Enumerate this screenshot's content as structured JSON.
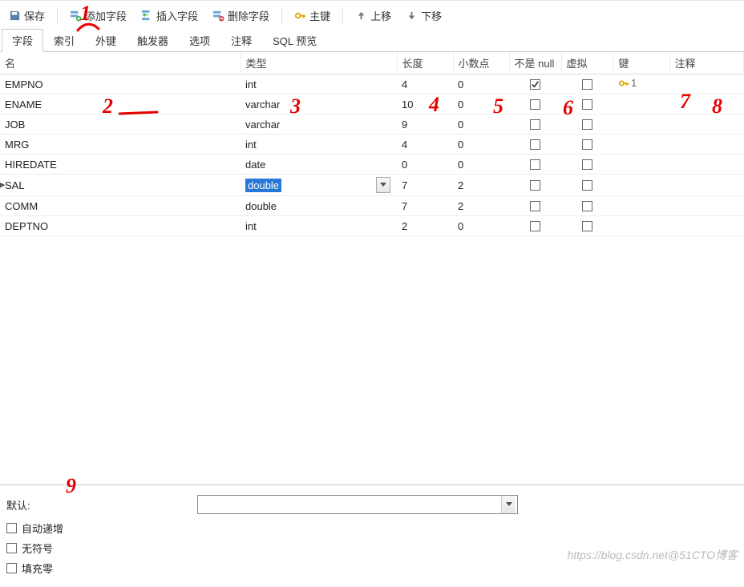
{
  "toolbar": {
    "save": "保存",
    "add_field": "添加字段",
    "insert_field": "插入字段",
    "delete_field": "删除字段",
    "primary_key": "主键",
    "move_up": "上移",
    "move_down": "下移"
  },
  "tabs": [
    {
      "id": "fields",
      "label": "字段",
      "active": true
    },
    {
      "id": "indexes",
      "label": "索引",
      "active": false
    },
    {
      "id": "fk",
      "label": "外键",
      "active": false
    },
    {
      "id": "triggers",
      "label": "触发器",
      "active": false
    },
    {
      "id": "options",
      "label": "选项",
      "active": false
    },
    {
      "id": "comment",
      "label": "注释",
      "active": false
    },
    {
      "id": "sql",
      "label": "SQL 预览",
      "active": false
    }
  ],
  "grid": {
    "headers": {
      "name": "名",
      "type": "类型",
      "length": "长度",
      "decimal": "小数点",
      "not_null": "不是 null",
      "virtual": "虚拟",
      "key": "键",
      "comment": "注释"
    },
    "rows": [
      {
        "name": "EMPNO",
        "type": "int",
        "length": "4",
        "decimal": "0",
        "nn": true,
        "virt": false,
        "pk": "1"
      },
      {
        "name": "ENAME",
        "type": "varchar",
        "length": "10",
        "decimal": "0",
        "nn": false,
        "virt": false,
        "pk": ""
      },
      {
        "name": "JOB",
        "type": "varchar",
        "length": "9",
        "decimal": "0",
        "nn": false,
        "virt": false,
        "pk": ""
      },
      {
        "name": "MRG",
        "type": "int",
        "length": "4",
        "decimal": "0",
        "nn": false,
        "virt": false,
        "pk": ""
      },
      {
        "name": "HIREDATE",
        "type": "date",
        "length": "0",
        "decimal": "0",
        "nn": false,
        "virt": false,
        "pk": ""
      },
      {
        "name": "SAL",
        "type": "double",
        "length": "7",
        "decimal": "2",
        "nn": false,
        "virt": false,
        "pk": "",
        "selected": true,
        "editing": true
      },
      {
        "name": "COMM",
        "type": "double",
        "length": "7",
        "decimal": "2",
        "nn": false,
        "virt": false,
        "pk": ""
      },
      {
        "name": "DEPTNO",
        "type": "int",
        "length": "2",
        "decimal": "0",
        "nn": false,
        "virt": false,
        "pk": ""
      }
    ]
  },
  "bottom": {
    "default_label": "默认:",
    "default_value": "",
    "auto_inc": "自动递增",
    "unsigned": "无符号",
    "zerofill": "填充零"
  },
  "annotations": {
    "n1": "1",
    "n2": "2",
    "n3": "3",
    "n4": "4",
    "n5": "5",
    "n6": "6",
    "n7": "7",
    "n8": "8",
    "n9": "9"
  },
  "watermark": "https://blog.csdn.net@51CTO博客"
}
